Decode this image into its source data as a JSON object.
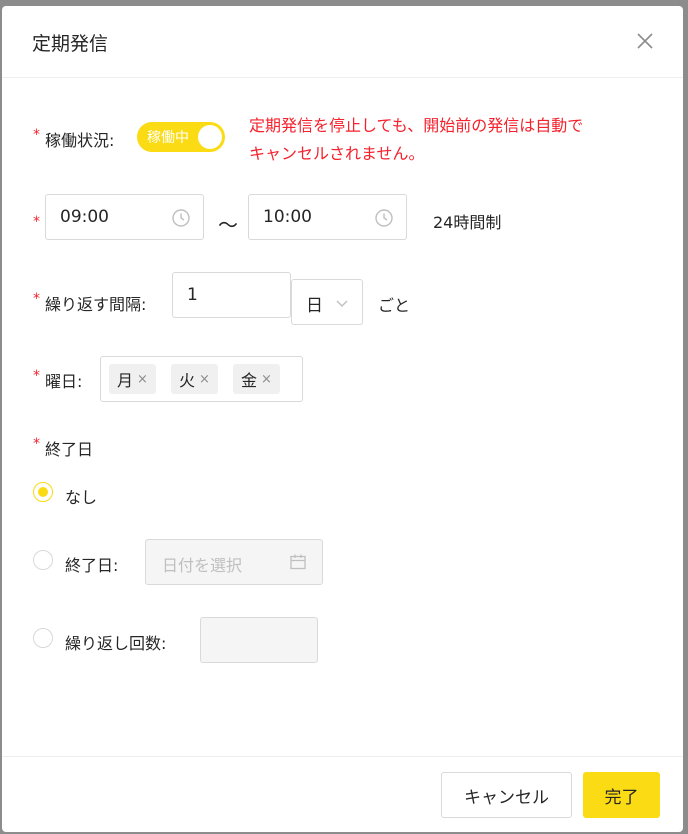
{
  "dialog": {
    "title": "定期発信",
    "close_icon": "close-icon"
  },
  "status": {
    "required_mark": "*",
    "label": "稼働状況:",
    "switch_label": "稼働中",
    "switch_on": true,
    "switch_color": "#fadb14",
    "warning_line1": "定期発信を停止しても、開始前の発信は自動で",
    "warning_line2": "キャンセルされません。",
    "warning_color": "#f5222d"
  },
  "time": {
    "required_mark": "*",
    "start": "09:00",
    "end": "10:00",
    "separator": "〜",
    "note": "24時間制"
  },
  "interval": {
    "required_mark": "*",
    "label": "繰り返す間隔:",
    "value": "1",
    "unit": "日",
    "suffix": "ごと"
  },
  "weekday": {
    "required_mark": "*",
    "label": "曜日:",
    "tags": [
      "月",
      "火",
      "金"
    ],
    "remove_glyph": "×"
  },
  "end_date": {
    "required_mark": "*",
    "label": "終了日",
    "options": [
      {
        "label": "なし",
        "checked": true
      },
      {
        "label": "終了日:",
        "checked": false,
        "placeholder": "日付を選択"
      },
      {
        "label": "繰り返し回数:",
        "checked": false
      }
    ]
  },
  "footer": {
    "cancel_label": "キャンセル",
    "done_label": "完了",
    "accent": "#fadb14"
  }
}
